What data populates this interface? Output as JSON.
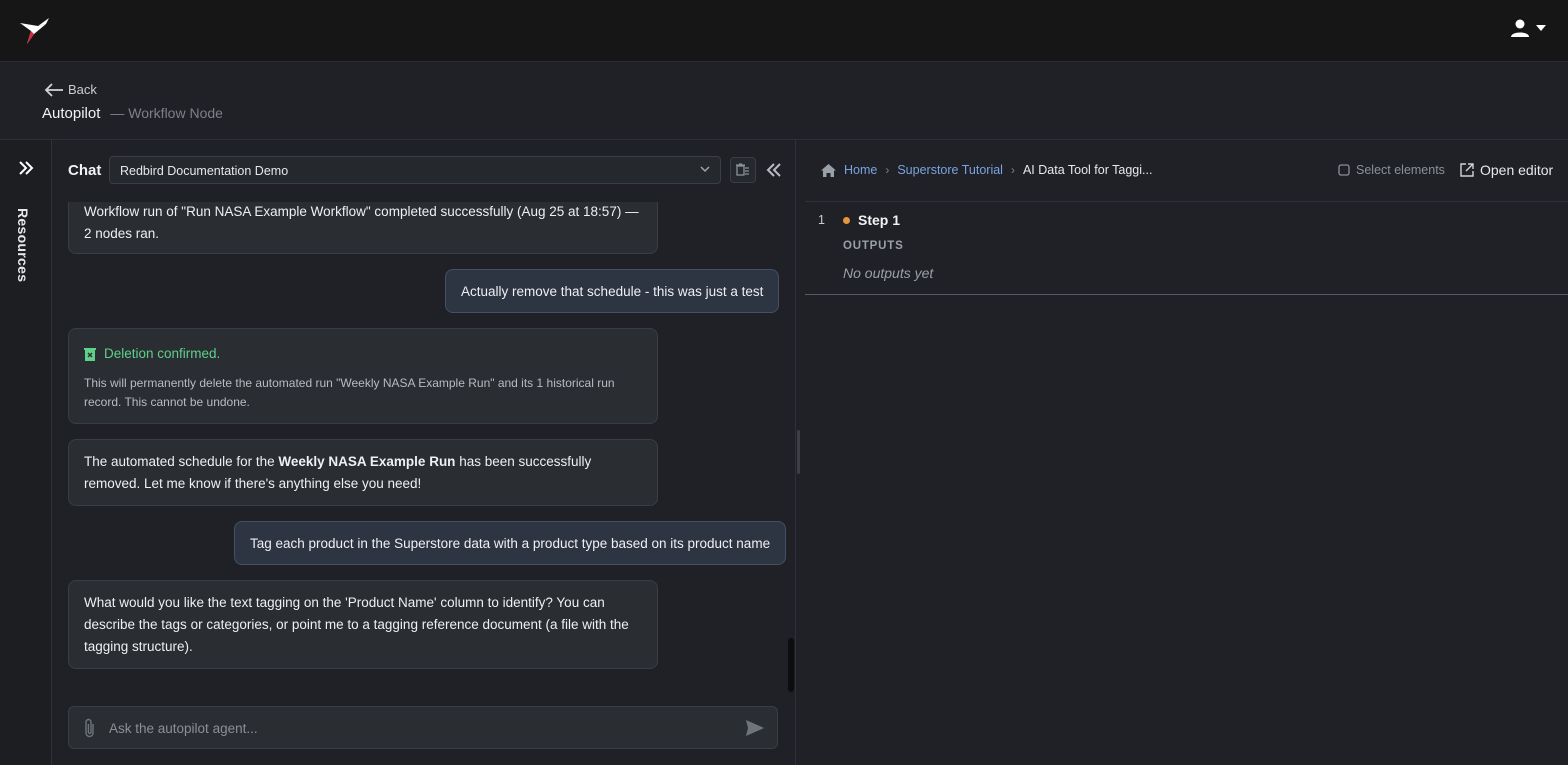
{
  "topbar": {
    "logo_icon": "hummingbird-logo",
    "user_icon": "user-icon"
  },
  "header": {
    "back_label": "Back",
    "title": "Autopilot",
    "subtitle": "— Workflow Node"
  },
  "rail": {
    "label": "Resources"
  },
  "chat": {
    "label": "Chat",
    "selected_conversation": "Redbird Documentation Demo",
    "input_placeholder": "Ask the autopilot agent...",
    "messages": {
      "m1_text": "Workflow run of \"Run NASA Example Workflow\" completed successfully (Aug 25 at 18:57) — 2 nodes ran.",
      "m2_user": "Actually remove that schedule - this was just a test",
      "m3_title": "Deletion confirmed.",
      "m3_body": "This will permanently delete the automated run \"Weekly NASA Example Run\" and its 1 historical run record. This cannot be undone.",
      "m4_prefix": "The automated schedule for the ",
      "m4_bold": "Weekly NASA Example Run",
      "m4_suffix": " has been successfully removed. Let me know if there's anything else you need!",
      "m5_user": "Tag each product in the Superstore data with a product type based on its product name",
      "m6_text": "What would you like the text tagging on the 'Product Name' column to identify? You can describe the tags or categories, or point me to a tagging reference document (a file with the tagging structure)."
    }
  },
  "right": {
    "breadcrumb": {
      "home": "Home",
      "project": "Superstore Tutorial",
      "current": "AI Data Tool for Taggi..."
    },
    "select_elements": "Select elements",
    "open_editor": "Open editor",
    "step": {
      "number": "1",
      "title": "Step 1",
      "outputs_label": "OUTPUTS",
      "outputs_empty": "No outputs yet",
      "status_color": "#e8963a"
    }
  },
  "colors": {
    "accent_link": "#7ba2e0",
    "success": "#5fd08a",
    "user_bubble": "#2d3442"
  }
}
